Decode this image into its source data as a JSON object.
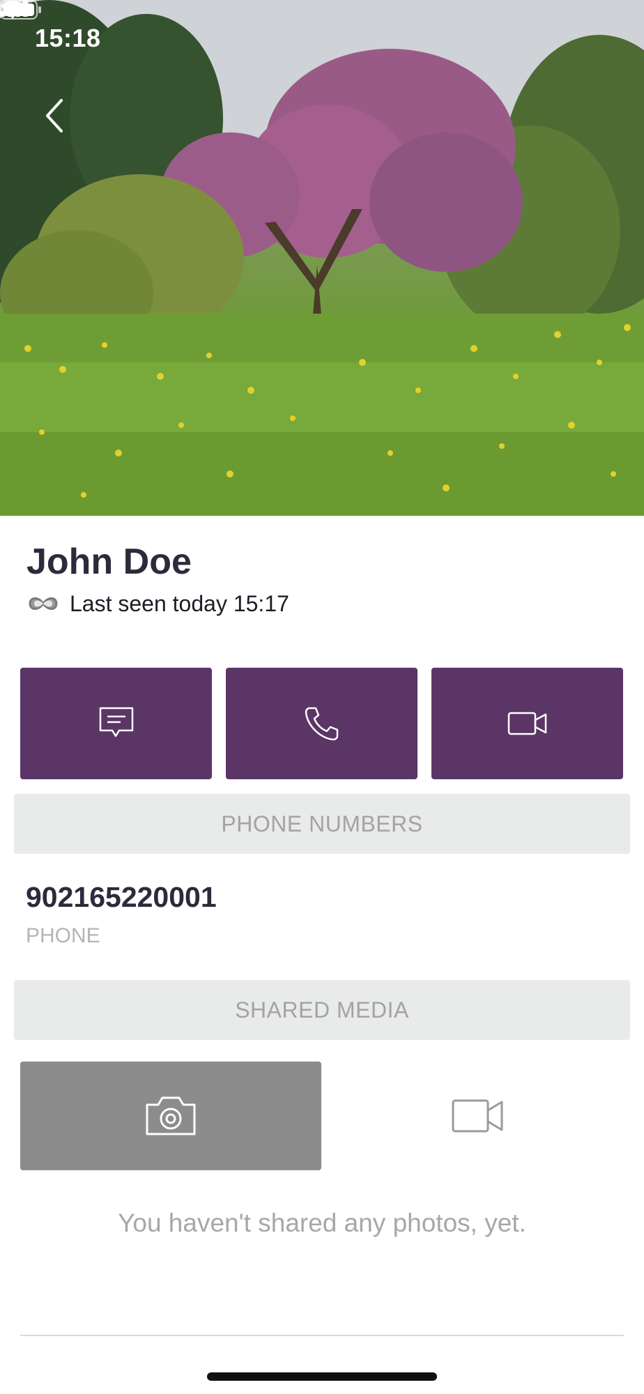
{
  "status_bar": {
    "time": "15:18"
  },
  "profile": {
    "name": "John Doe",
    "presence": "Last seen today 15:17"
  },
  "sections": {
    "phone_numbers": "PHONE NUMBERS",
    "shared_media": "SHARED MEDIA"
  },
  "phone": {
    "number": "902165220001",
    "type": "PHONE"
  },
  "shared_media": {
    "active_tab": "photos",
    "empty_message": "You haven't shared any photos, yet."
  },
  "icons": {
    "back": "chevron-left-icon",
    "message": "chat-bubble-icon",
    "call": "phone-icon",
    "video": "video-camera-icon",
    "photos_tab": "camera-icon",
    "videos_tab": "video-camera-icon",
    "presence": "infinity-icon"
  },
  "colors": {
    "accent": "#5a3566",
    "section_bg": "#e9eaea",
    "section_text": "#a3a3a3",
    "active_tab_bg": "#8c8c8c"
  }
}
